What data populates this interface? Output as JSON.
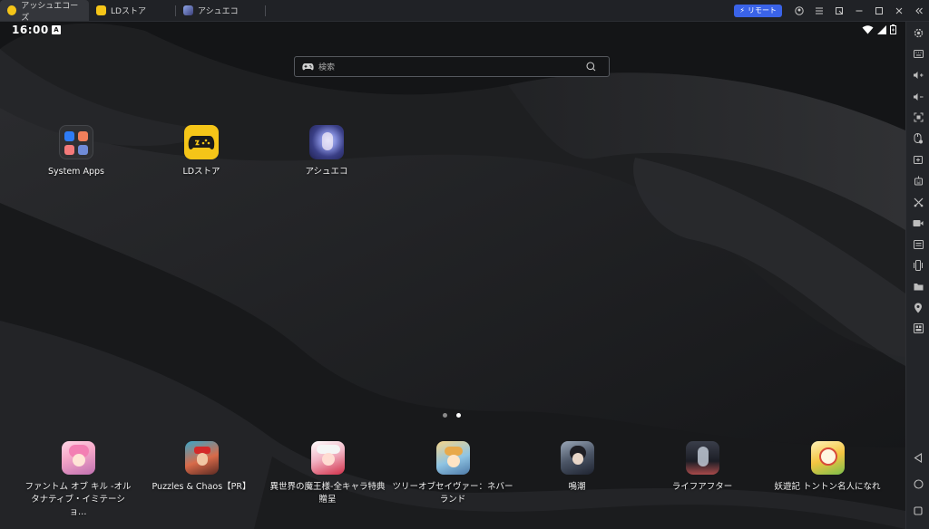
{
  "tabs": [
    {
      "label": "アッシュエコーズ",
      "active": true
    },
    {
      "label": "LDストア",
      "active": false
    },
    {
      "label": "アシュエコ",
      "active": false
    }
  ],
  "titlebar": {
    "remote_label": "リモート"
  },
  "status": {
    "time": "16:00",
    "notif": "A"
  },
  "search": {
    "placeholder": "検索"
  },
  "home_apps": [
    {
      "label": "System Apps"
    },
    {
      "label": "LDストア"
    },
    {
      "label": "アシュエコ"
    }
  ],
  "dock_apps": [
    {
      "label": "ファントム オブ キル -オルタナティブ・イミテーショ…"
    },
    {
      "label": "Puzzles & Chaos【PR】"
    },
    {
      "label": "異世界の魔王様-全キャラ特典贈呈"
    },
    {
      "label": "ツリーオブセイヴァー：ネバーランド"
    },
    {
      "label": "鳴潮"
    },
    {
      "label": "ライフアフター"
    },
    {
      "label": "妖遊記 トントン名人になれ"
    }
  ],
  "colors": {
    "accent": "#3a63e8",
    "ldstore_yellow": "#f5c518",
    "background": "#1b1c1e"
  },
  "page_indicator": {
    "pages": 2,
    "current": 2
  }
}
